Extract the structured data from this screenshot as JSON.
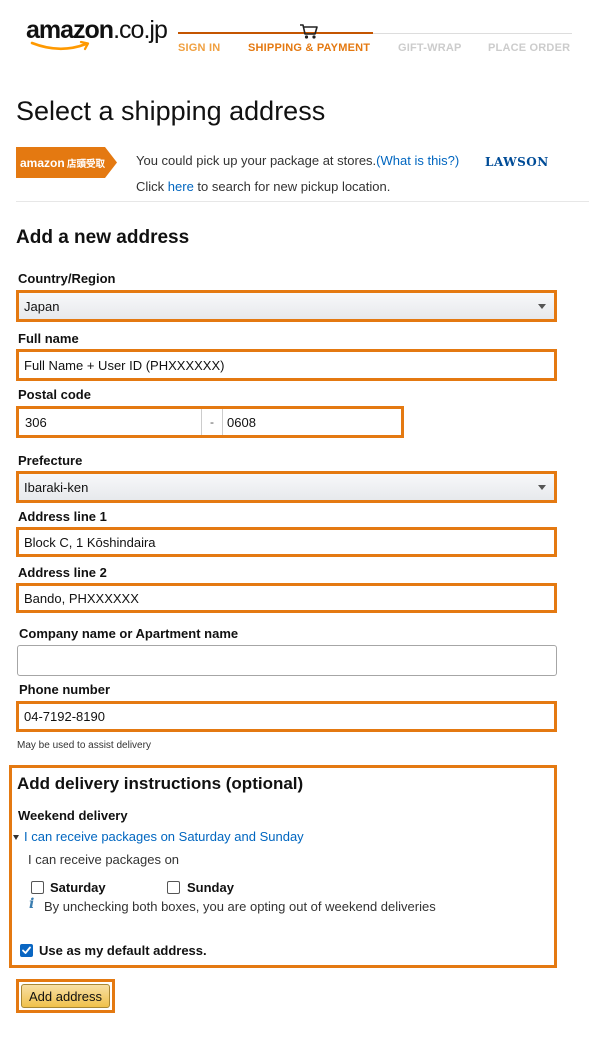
{
  "header": {
    "logo_text": "amazon",
    "logo_suffix": ".co.jp",
    "steps": [
      {
        "label": "SIGN IN",
        "state": "done"
      },
      {
        "label": "SHIPPING & PAYMENT",
        "state": "active"
      },
      {
        "label": "GIFT-WRAP",
        "state": "future"
      },
      {
        "label": "PLACE ORDER",
        "state": "future"
      }
    ],
    "cart_icon": "cart-icon"
  },
  "page_title": "Select a shipping address",
  "pickup": {
    "badge_brand": "amazon",
    "badge_text": "店頭受取",
    "line1": "You could pick up your package at stores.",
    "what_link": "(What is this?)",
    "line2_prefix": "Click ",
    "here_link": "here",
    "line2_suffix": " to search for new pickup location.",
    "partner": "LAWSON"
  },
  "form": {
    "heading": "Add a new address",
    "country": {
      "label": "Country/Region",
      "value": "Japan"
    },
    "full_name": {
      "label": "Full name",
      "value": "Full Name + User ID (PHXXXXXX)"
    },
    "postal": {
      "label": "Postal code",
      "part1": "306",
      "separator": "-",
      "part2": "0608"
    },
    "prefecture": {
      "label": "Prefecture",
      "value": "Ibaraki-ken"
    },
    "address1": {
      "label": "Address line 1",
      "value": "Block C, 1 Kōshindaira"
    },
    "address2": {
      "label": "Address line 2",
      "value": "Bando, PHXXXXXX"
    },
    "company": {
      "label": "Company name or Apartment name",
      "value": ""
    },
    "phone": {
      "label": "Phone number",
      "value": "04-7192-8190",
      "hint": "May be used to assist delivery"
    }
  },
  "instructions": {
    "title": "Add delivery instructions (optional)",
    "weekend_label": "Weekend delivery",
    "expander": "I can receive packages on Saturday and Sunday",
    "receive_text": "I can receive packages on",
    "saturday": {
      "label": "Saturday",
      "checked": false
    },
    "sunday": {
      "label": "Sunday",
      "checked": false
    },
    "info_icon": "info-icon",
    "info_text": "By unchecking both boxes, you are opting out of weekend deliveries",
    "default_address": {
      "label": "Use as my default address.",
      "checked": true
    }
  },
  "submit_label": "Add address",
  "colors": {
    "highlight": "#e47911",
    "link": "#0066c0",
    "button": "#f0c14b"
  }
}
